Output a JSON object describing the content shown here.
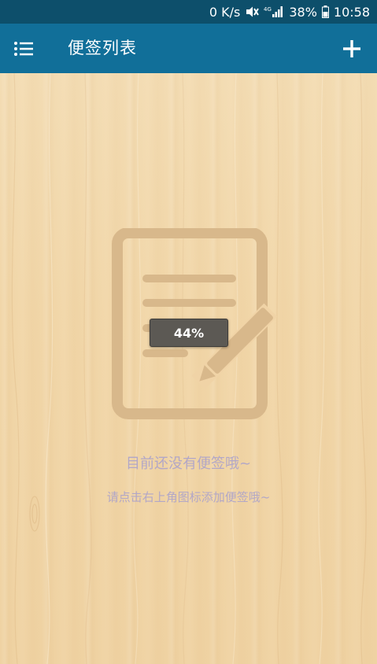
{
  "status_bar": {
    "net_speed": "0 K/s",
    "network_type": "4G",
    "battery": "38%",
    "time": "10:58",
    "icons": [
      "mute-icon",
      "signal-icon",
      "battery-icon"
    ]
  },
  "app_bar": {
    "title": "便签列表",
    "menu_icon": "list-menu-icon",
    "add_icon": "plus-icon",
    "color": "#116f99"
  },
  "empty_state": {
    "illustration_icon": "note-edit-icon",
    "title": "目前还没有便签哦~",
    "hint": "请点击右上角图标添加便签哦~"
  },
  "toast": {
    "progress_text": "44%"
  },
  "colors": {
    "status_bar": "#0d4f6b",
    "app_bar": "#116f99",
    "background": "#f2d7ab",
    "empty_text": "#b2a7c7",
    "illustration": "#d7b68a"
  }
}
